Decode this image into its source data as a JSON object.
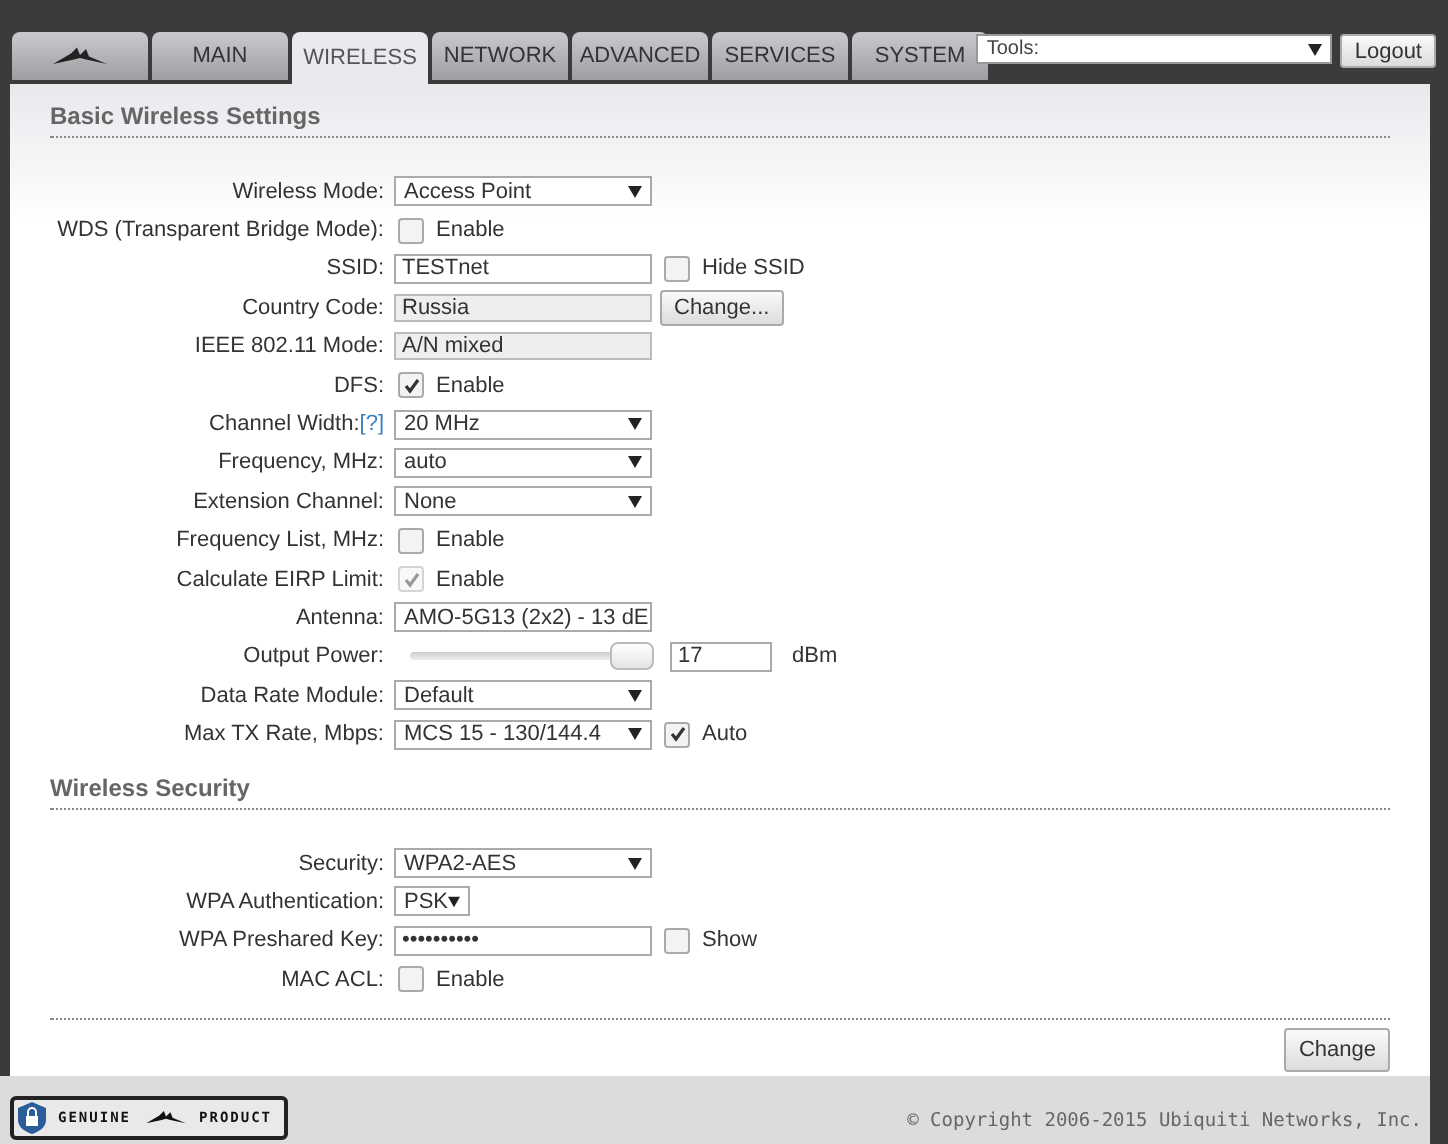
{
  "tabs": [
    {
      "kind": "logo",
      "selected": false
    },
    {
      "kind": "text",
      "label": "MAIN",
      "selected": false
    },
    {
      "kind": "text",
      "label": "WIRELESS",
      "selected": true
    },
    {
      "kind": "text",
      "label": "NETWORK",
      "selected": false
    },
    {
      "kind": "text",
      "label": "ADVANCED",
      "selected": false
    },
    {
      "kind": "text",
      "label": "SERVICES",
      "selected": false
    },
    {
      "kind": "text",
      "label": "SYSTEM",
      "selected": false
    }
  ],
  "tools": {
    "value": "Tools:"
  },
  "logout": "Logout",
  "sections": [
    {
      "title": "Basic Wireless Settings",
      "rows": [
        {
          "label": "Wireless Mode:",
          "controls": [
            {
              "kind": "select",
              "value": "Access Point"
            }
          ]
        },
        {
          "label": "WDS (Transparent Bridge Mode):",
          "controls": [
            {
              "kind": "checkbox",
              "checked": false,
              "disabled": false,
              "label": "Enable"
            }
          ]
        },
        {
          "label": "SSID:",
          "controls": [
            {
              "kind": "input",
              "value": "TESTnet"
            },
            {
              "kind": "checkbox",
              "checked": false,
              "disabled": false,
              "label": "Hide SSID"
            }
          ]
        },
        {
          "label": "Country Code:",
          "controls": [
            {
              "kind": "readonly",
              "value": "Russia"
            },
            {
              "kind": "button",
              "label": "Change..."
            }
          ]
        },
        {
          "label": "IEEE 802.11 Mode:",
          "controls": [
            {
              "kind": "readonly",
              "value": "A/N mixed"
            }
          ]
        },
        {
          "label": "DFS:",
          "controls": [
            {
              "kind": "checkbox",
              "checked": true,
              "disabled": false,
              "label": "Enable"
            }
          ]
        },
        {
          "label": "Channel Width:",
          "help": "[?]",
          "controls": [
            {
              "kind": "select",
              "value": "20 MHz"
            }
          ]
        },
        {
          "label": "Frequency, MHz:",
          "controls": [
            {
              "kind": "select",
              "value": "auto"
            }
          ]
        },
        {
          "label": "Extension Channel:",
          "controls": [
            {
              "kind": "select",
              "value": "None"
            }
          ]
        },
        {
          "label": "Frequency List, MHz:",
          "controls": [
            {
              "kind": "checkbox",
              "checked": false,
              "disabled": false,
              "label": "Enable"
            }
          ]
        },
        {
          "label": "Calculate EIRP Limit:",
          "controls": [
            {
              "kind": "checkbox",
              "checked": true,
              "disabled": true,
              "label": "Enable"
            }
          ]
        },
        {
          "label": "Antenna:",
          "controls": [
            {
              "kind": "select",
              "value": "AMO-5G13 (2x2) - 13 dE"
            }
          ]
        },
        {
          "label": "Output Power:",
          "controls": [
            {
              "kind": "slider",
              "level": 1
            },
            {
              "kind": "short-input",
              "value": "17"
            },
            {
              "kind": "unit",
              "label": "dBm"
            }
          ]
        },
        {
          "label": "Data Rate Module:",
          "controls": [
            {
              "kind": "select",
              "value": "Default"
            }
          ]
        },
        {
          "label": "Max TX Rate, Mbps:",
          "controls": [
            {
              "kind": "select",
              "value": "MCS 15 - 130/144.4"
            },
            {
              "kind": "checkbox",
              "checked": true,
              "disabled": false,
              "label": "Auto"
            }
          ]
        }
      ]
    },
    {
      "title": "Wireless Security",
      "rows": [
        {
          "label": "Security:",
          "controls": [
            {
              "kind": "select",
              "value": "WPA2-AES"
            }
          ]
        },
        {
          "label": "WPA Authentication:",
          "controls": [
            {
              "kind": "small-select",
              "value": "PSK"
            }
          ]
        },
        {
          "label": "WPA Preshared Key:",
          "controls": [
            {
              "kind": "input",
              "value": "••••••••••"
            },
            {
              "kind": "checkbox",
              "checked": false,
              "disabled": false,
              "label": "Show"
            }
          ]
        },
        {
          "label": "MAC ACL:",
          "controls": [
            {
              "kind": "checkbox",
              "checked": false,
              "disabled": false,
              "label": "Enable"
            }
          ]
        }
      ]
    }
  ],
  "change_button": "Change",
  "badge": {
    "left": "GENUINE",
    "right": "PRODUCT"
  },
  "copyright": "© Copyright 2006-2015 Ubiquiti Networks, Inc."
}
